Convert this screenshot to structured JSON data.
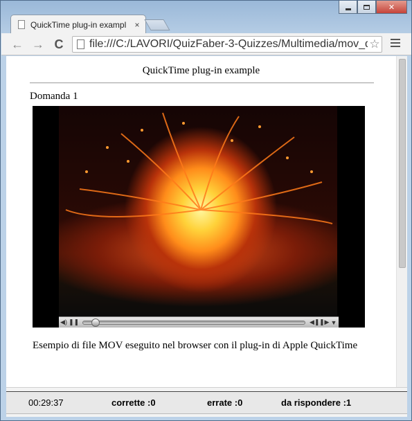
{
  "browser": {
    "tab_title": "QuickTime plug-in exampl",
    "tab_close": "×",
    "url": "file:///C:/LAVORI/QuizFaber-3-Quizzes/Multimedia/mov_q",
    "nav": {
      "back": "←",
      "forward": "→",
      "reload": "C"
    },
    "star": "☆"
  },
  "page": {
    "title": "QuickTime plug-in example",
    "question_label": "Domanda 1",
    "caption": "Esempio di file MOV eseguito nel browser con il plug-in di Apple QuickTime"
  },
  "player": {
    "progress": 0.04
  },
  "status": {
    "timer": "00:29:37",
    "correct": "corrette :0",
    "wrong": "errate :0",
    "remaining": "da rispondere :1"
  }
}
